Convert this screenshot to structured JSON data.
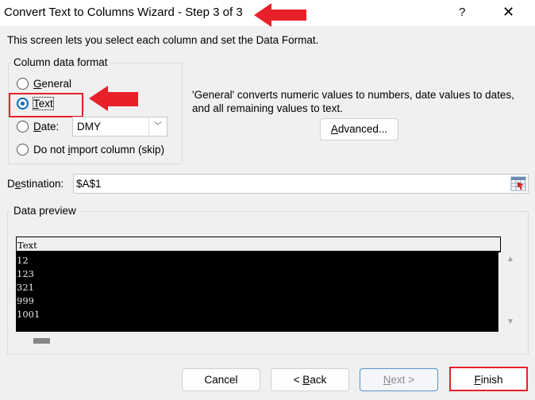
{
  "window": {
    "title": "Convert Text to Columns Wizard - Step 3 of 3",
    "help_glyph": "?",
    "close_glyph": "✕"
  },
  "intro": "This screen lets you select each column and set the Data Format.",
  "column_data_format": {
    "label": "Column data format",
    "options": [
      {
        "label_pre": "",
        "mnemonic": "G",
        "label_post": "eneral",
        "checked": false
      },
      {
        "label_pre": "",
        "mnemonic": "T",
        "label_post": "ext",
        "checked": true
      },
      {
        "label_pre": "",
        "mnemonic": "D",
        "label_post": "ate:",
        "checked": false
      },
      {
        "label_pre": "Do not ",
        "mnemonic": "i",
        "label_post": "mport column (skip)",
        "checked": false
      }
    ],
    "date_format": "DMY"
  },
  "description": "'General' converts numeric values to numbers, date values to dates, and all remaining values to text.",
  "advanced_button": {
    "mnemonic": "A",
    "rest": "dvanced..."
  },
  "destination": {
    "label_pre": "D",
    "mnemonic": "e",
    "label_post": "stination:",
    "value": "$A$1"
  },
  "data_preview": {
    "label": "Data preview",
    "header": "Text",
    "rows": [
      "12",
      "123",
      "321",
      "999",
      "1001"
    ]
  },
  "buttons": {
    "cancel": "Cancel",
    "back": {
      "pre": "< ",
      "mnemonic": "B",
      "rest": "ack"
    },
    "next": {
      "mnemonic": "N",
      "rest": "ext >"
    },
    "finish": {
      "mnemonic": "F",
      "rest": "inish"
    }
  },
  "annotation_color": "#e8202a"
}
